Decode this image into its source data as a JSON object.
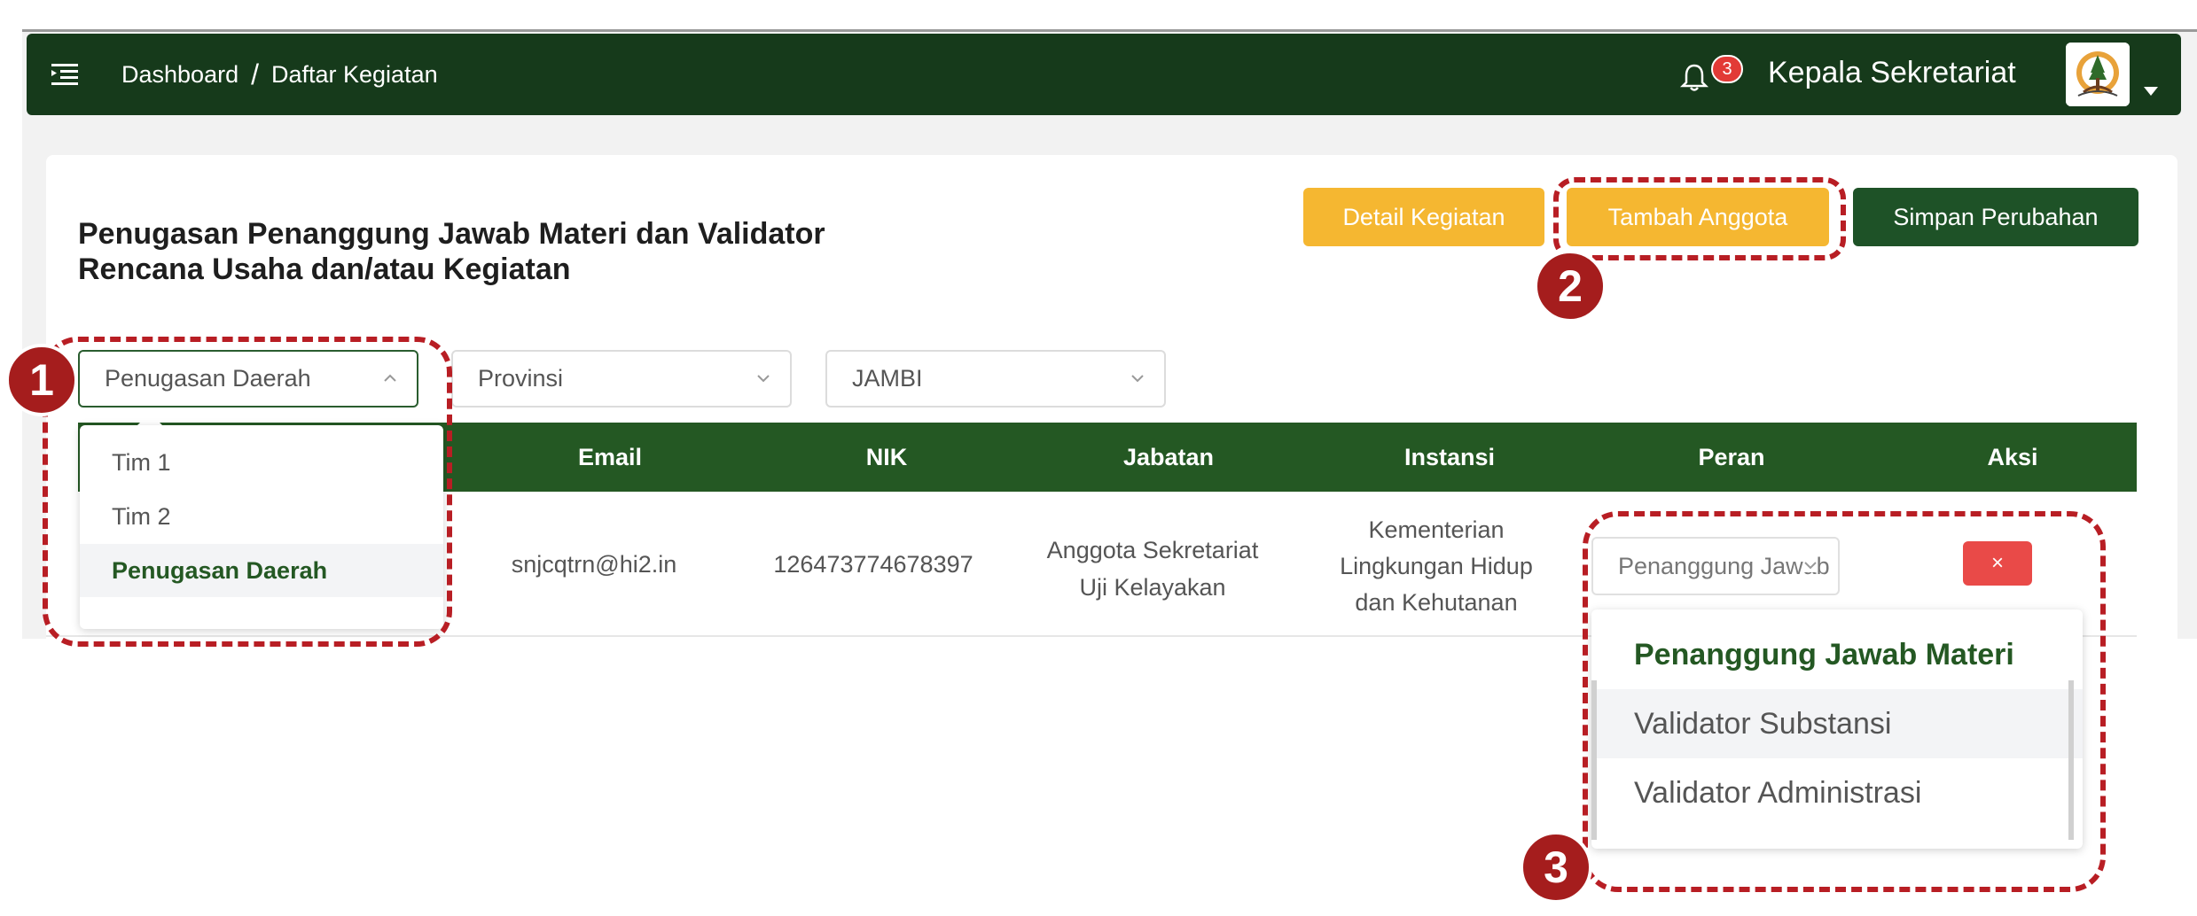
{
  "navbar": {
    "breadcrumb": [
      "Dashboard",
      "Daftar Kegiatan"
    ],
    "separator": "/",
    "notification_count": "3",
    "user_name": "Kepala Sekretariat"
  },
  "page": {
    "title_line1": "Penugasan Penanggung Jawab Materi dan Validator",
    "title_line2": "Rencana Usaha dan/atau Kegiatan"
  },
  "toolbar": {
    "detail_label": "Detail Kegiatan",
    "add_member_label": "Tambah Anggota",
    "save_label": "Simpan Perubahan"
  },
  "filters": {
    "assignment": "Penugasan Daerah",
    "province_placeholder": "Provinsi",
    "region": "JAMBI"
  },
  "assignment_options": [
    "Tim 1",
    "Tim 2",
    "Penugasan Daerah"
  ],
  "table": {
    "columns": [
      "Email",
      "NIK",
      "Jabatan",
      "Instansi",
      "Peran",
      "Aksi"
    ],
    "row": {
      "email": "snjcqtrn@hi2.in",
      "nik": "126473774678397",
      "jabatan_line1": "Anggota Sekretariat",
      "jabatan_line2": "Uji Kelayakan",
      "instansi_line1": "Kementerian",
      "instansi_line2": "Lingkungan Hidup",
      "instansi_line3": "dan Kehutanan",
      "peran": "Penanggung Jawab Materi",
      "aksi": "×"
    }
  },
  "role_options": [
    "Penanggung Jawab Materi",
    "Validator Substansi",
    "Validator Administrasi"
  ],
  "annotations": [
    "1",
    "2",
    "3"
  ],
  "colors": {
    "navbar": "#163a1b",
    "table_header": "#245823",
    "yellow_button": "#f5b731",
    "green_button": "#1e5227",
    "danger": "#e94a48",
    "annotation": "#b81e24"
  }
}
